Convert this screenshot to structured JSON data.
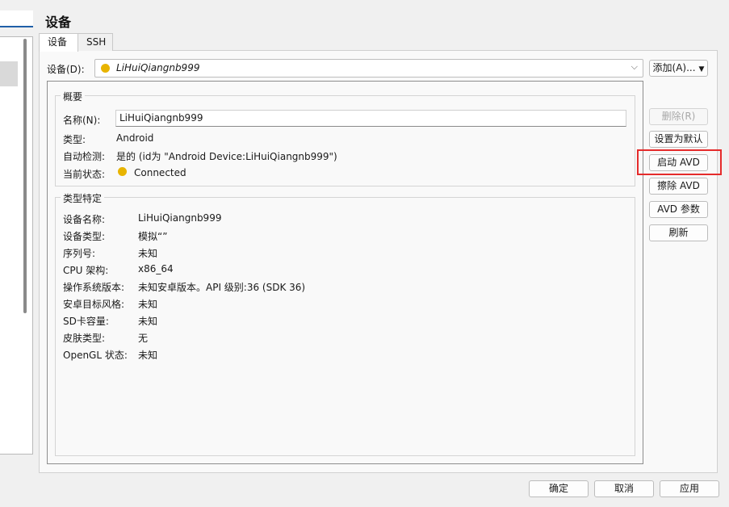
{
  "page": {
    "title": "设备"
  },
  "tabs": [
    {
      "label": "设备",
      "active": true
    },
    {
      "label": "SSH",
      "active": false
    }
  ],
  "device": {
    "label": "设备(D):",
    "selected": "LiHuiQiangnb999",
    "status_color": "#e8b400",
    "add_button": "添加(A)..."
  },
  "overview": {
    "title": "概要",
    "name_label": "名称(N):",
    "name_value": "LiHuiQiangnb999",
    "type_label": "类型:",
    "type_value": "Android",
    "autodetect_label": "自动检测:",
    "autodetect_value": "是的 (id为 \"Android Device:LiHuiQiangnb999\")",
    "status_label": "当前状态:",
    "status_value": "Connected"
  },
  "type_specific": {
    "title": "类型特定",
    "rows": [
      {
        "label": "设备名称:",
        "value": "LiHuiQiangnb999"
      },
      {
        "label": "设备类型:",
        "value": "模拟“”"
      },
      {
        "label": "序列号:",
        "value": "未知"
      },
      {
        "label": "CPU 架构:",
        "value": "x86_64"
      },
      {
        "label": "操作系统版本:",
        "value": "未知安卓版本。API 级别:36 (SDK 36)"
      },
      {
        "label": "安卓目标风格:",
        "value": "未知"
      },
      {
        "label": "SD卡容量:",
        "value": "未知"
      },
      {
        "label": "皮肤类型:",
        "value": "无"
      },
      {
        "label": "OpenGL 状态:",
        "value": "未知"
      }
    ]
  },
  "side_buttons": {
    "delete": "删除(R)",
    "set_default": "设置为默认",
    "start_avd": "启动 AVD",
    "wipe_avd": "擦除 AVD",
    "avd_params": "AVD 参数",
    "refresh": "刷新"
  },
  "bottom_buttons": {
    "ok": "确定",
    "cancel": "取消",
    "apply": "应用"
  },
  "colors": {
    "highlight": "#e52b2b",
    "accent": "#1f5fa8"
  }
}
